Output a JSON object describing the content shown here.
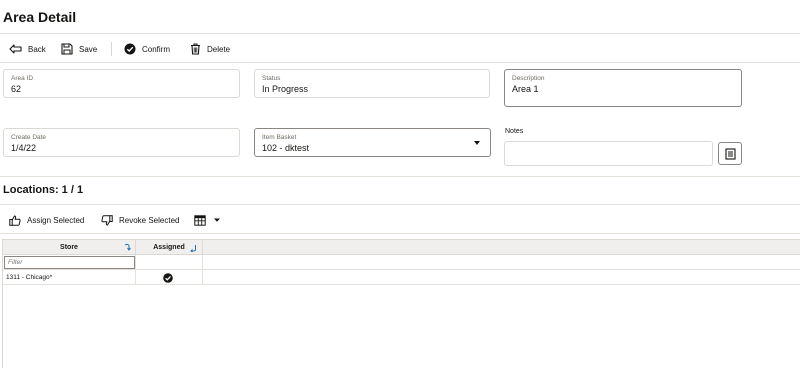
{
  "page": {
    "title": "Area Detail"
  },
  "toolbar": {
    "back_label": "Back",
    "save_label": "Save",
    "confirm_label": "Confirm",
    "delete_label": "Delete"
  },
  "fields": {
    "area_id": {
      "label": "Area ID",
      "value": "62"
    },
    "status": {
      "label": "Status",
      "value": "In Progress"
    },
    "description": {
      "label": "Description",
      "value": "Area 1"
    },
    "create_date": {
      "label": "Create Date",
      "value": "1/4/22"
    },
    "item_basket": {
      "label": "Item Basket",
      "value": "102 - dktest"
    },
    "notes": {
      "label": "Notes",
      "value": ""
    }
  },
  "locations": {
    "title": "Locations: 1 / 1",
    "assign_label": "Assign Selected",
    "revoke_label": "Revoke Selected"
  },
  "grid": {
    "columns": [
      "Store",
      "Assigned"
    ],
    "filter_placeholder": "Filter",
    "rows": [
      {
        "store": "1311 - Chicago*",
        "assigned": true
      }
    ]
  },
  "icons": {
    "back": "back-arrow-icon",
    "save": "save-icon",
    "confirm": "check-circle-icon",
    "delete": "trash-icon",
    "notes": "notes-icon",
    "assign": "thumbs-up-icon",
    "revoke": "thumbs-down-icon",
    "view": "table-view-icon"
  }
}
